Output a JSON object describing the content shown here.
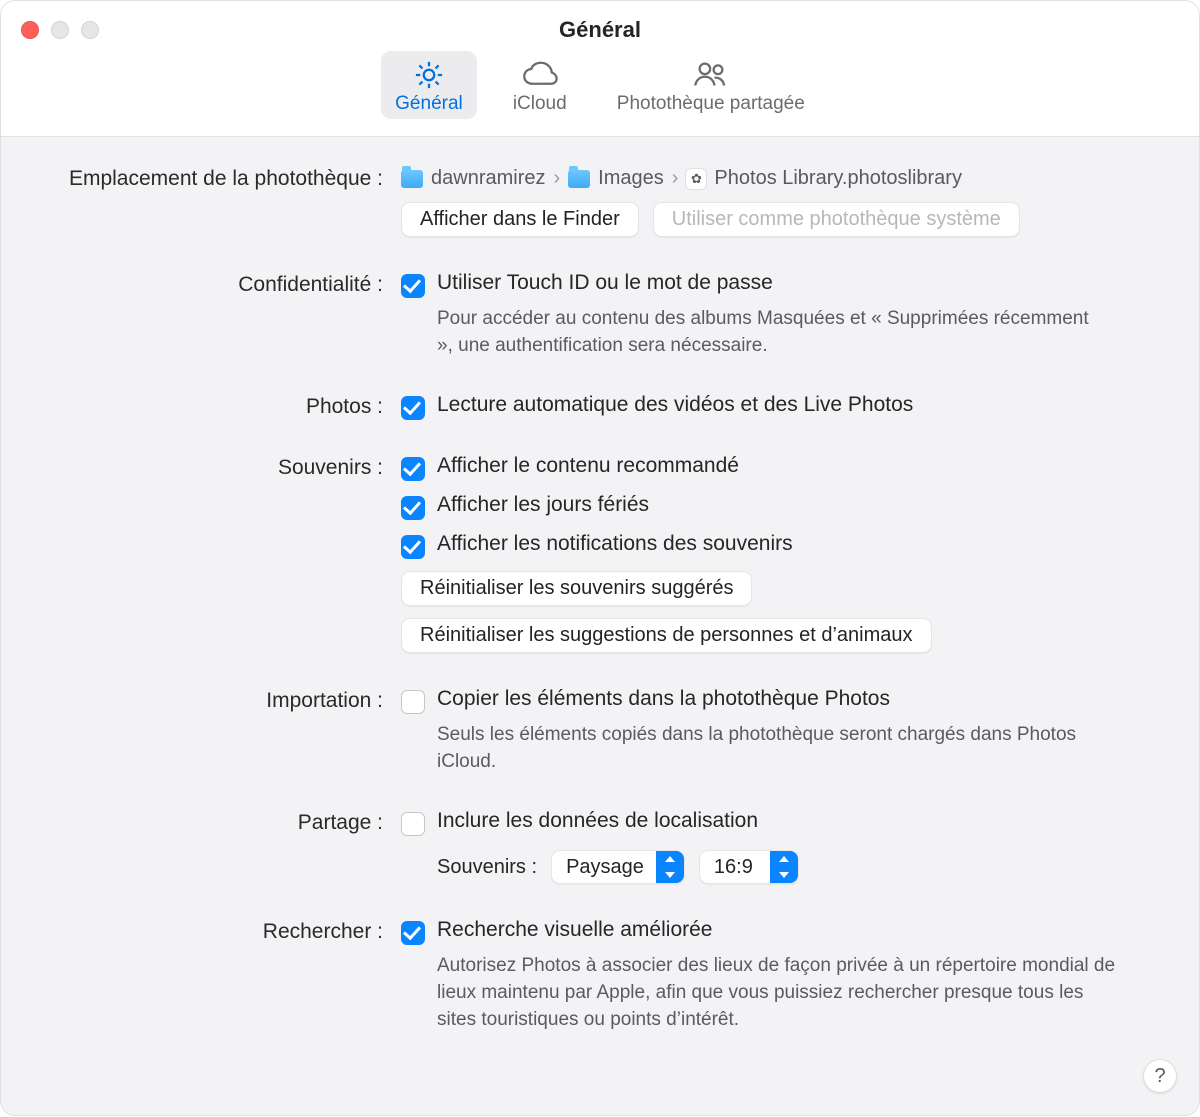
{
  "window": {
    "title": "Général"
  },
  "tabs": {
    "general": "Général",
    "icloud": "iCloud",
    "shared": "Photothèque partagée"
  },
  "library": {
    "label": "Emplacement de la photothèque :",
    "crumbs": [
      "dawnramirez",
      "Images",
      "Photos Library.photoslibrary"
    ],
    "show_in_finder": "Afficher dans le Finder",
    "use_as_system": "Utiliser comme photothèque système"
  },
  "privacy": {
    "label": "Confidentialité :",
    "checkbox": "Utiliser Touch ID ou le mot de passe",
    "help": "Pour accéder au contenu des albums Masquées et « Supprimées récemment », une authentification sera nécessaire."
  },
  "photos": {
    "label": "Photos :",
    "checkbox": "Lecture automatique des vidéos et des Live Photos"
  },
  "memories": {
    "label": "Souvenirs :",
    "c1": "Afficher le contenu recommandé",
    "c2": "Afficher les jours fériés",
    "c3": "Afficher les notifications des souvenirs",
    "reset_memories": "Réinitialiser les souvenirs suggérés",
    "reset_people": "Réinitialiser les suggestions de personnes et d’animaux"
  },
  "import": {
    "label": "Importation :",
    "checkbox": "Copier les éléments dans la photothèque Photos",
    "help": "Seuls les éléments copiés dans la photothèque seront chargés dans Photos iCloud."
  },
  "sharing": {
    "label": "Partage :",
    "checkbox": "Inclure les données de localisation",
    "memories_label": "Souvenirs :",
    "select1": "Paysage",
    "select2": "16:9"
  },
  "lookup": {
    "label": "Rechercher :",
    "checkbox": "Recherche visuelle améliorée",
    "help": "Autorisez Photos à associer des lieux de façon privée à un répertoire mondial de lieux maintenu par Apple, afin que vous puissiez rechercher presque tous les sites touristiques ou points d’intérêt."
  },
  "help_button": "?"
}
